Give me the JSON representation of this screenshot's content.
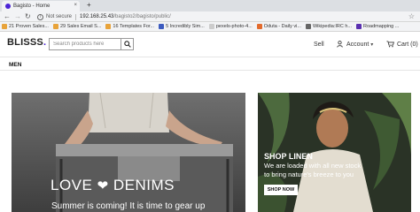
{
  "browser": {
    "tab_title": "Bagisto - Home",
    "tab_close": "×",
    "new_tab": "+",
    "not_secure": "Not secure",
    "url_host": "192.168.25.43",
    "url_path": "/bagisto2/bagisto/public/",
    "bookmarks": [
      {
        "label": "21 Proven Sales...",
        "color": "#e8a33a"
      },
      {
        "label": "29 Sales Email S...",
        "color": "#e8a33a"
      },
      {
        "label": "16 Templates For...",
        "color": "#e8a33a"
      },
      {
        "label": "5 Incredibly Sim...",
        "color": "#3c5bbf"
      },
      {
        "label": "pexels-photo-4...",
        "color": "#cccccc"
      },
      {
        "label": "Oduta - Daily vi...",
        "color": "#e36b2d"
      },
      {
        "label": "Wikipedia:IRC h...",
        "color": "#666666"
      },
      {
        "label": "Roadmapping ...",
        "color": "#5a2fb0"
      }
    ]
  },
  "header": {
    "logo": "BLISSS",
    "logo_dot": ".",
    "search_placeholder": "Search products here",
    "sell": "Sell",
    "account": "Account",
    "cart": "Cart (0)"
  },
  "menu": {
    "men": "MEN"
  },
  "hero": {
    "title_part1": "LOVE",
    "title_part2": "DENIMS",
    "subtitle": "Summer is coming! It is time to gear up"
  },
  "linen": {
    "title": "SHOP LINEN",
    "description": "We are loaded with all new stock to bring nature's breeze to you",
    "button": "SHOP NOW"
  },
  "colors": {
    "brand": "#4b24d6"
  }
}
